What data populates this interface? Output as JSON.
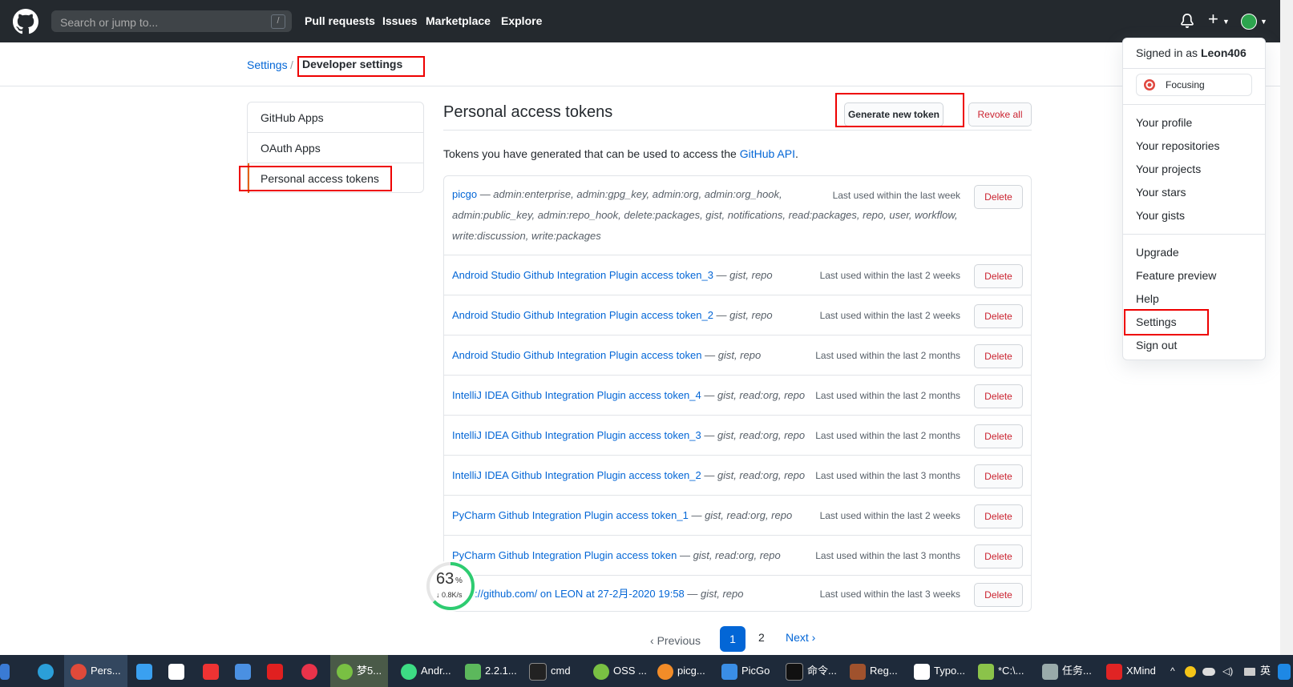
{
  "header": {
    "search_placeholder": "Search or jump to...",
    "search_key": "/",
    "nav": [
      "Pull requests",
      "Issues",
      "Marketplace",
      "Explore"
    ]
  },
  "breadcrumb": {
    "settings": "Settings",
    "separator": "/",
    "current": "Developer settings"
  },
  "sidebar": {
    "items": [
      "GitHub Apps",
      "OAuth Apps",
      "Personal access tokens"
    ]
  },
  "main": {
    "title": "Personal access tokens",
    "generate_label": "Generate new token",
    "revoke_label": "Revoke all",
    "desc_text": "Tokens you have generated that can be used to access the ",
    "desc_link": "GitHub API",
    "desc_end": "."
  },
  "tokens": [
    {
      "name": "picgo",
      "scopes_line1": " — admin:enterprise, admin:gpg_key, admin:org, admin:org_hook,",
      "scopes_line2": "admin:public_key, admin:repo_hook, delete:packages, gist, notifications, read:packages, repo, user, workflow,",
      "scopes_line3": "write:discussion, write:packages",
      "last_used": "Last used within the last week",
      "delete": "Delete"
    },
    {
      "name": "Android Studio Github Integration Plugin access token_3",
      "scopes": " — gist, repo",
      "last_used": "Last used within the last 2 weeks",
      "delete": "Delete"
    },
    {
      "name": "Android Studio Github Integration Plugin access token_2",
      "scopes": " — gist, repo",
      "last_used": "Last used within the last 2 weeks",
      "delete": "Delete"
    },
    {
      "name": "Android Studio Github Integration Plugin access token",
      "scopes": " — gist, repo",
      "last_used": "Last used within the last 2 months",
      "delete": "Delete"
    },
    {
      "name": "IntelliJ IDEA Github Integration Plugin access token_4",
      "scopes": " — gist, read:org, repo",
      "last_used": "Last used within the last 2 months",
      "delete": "Delete"
    },
    {
      "name": "IntelliJ IDEA Github Integration Plugin access token_3",
      "scopes": " — gist, read:org, repo",
      "last_used": "Last used within the last 2 months",
      "delete": "Delete"
    },
    {
      "name": "IntelliJ IDEA Github Integration Plugin access token_2",
      "scopes": " — gist, read:org, repo",
      "last_used": "Last used within the last 3 months",
      "delete": "Delete"
    },
    {
      "name": "PyCharm Github Integration Plugin access token_1",
      "scopes": " — gist, read:org, repo",
      "last_used": "Last used within the last 2 weeks",
      "delete": "Delete"
    },
    {
      "name": "PyCharm Github Integration Plugin access token",
      "scopes": " — gist, read:org, repo",
      "last_used": "Last used within the last 3 months",
      "delete": "Delete"
    },
    {
      "name": "https://github.com/ on LEON at 27-2月-2020 19:58",
      "scopes": " — gist, repo",
      "last_used": "Last used within the last 3 weeks",
      "delete": "Delete"
    }
  ],
  "pagination": {
    "previous": "Previous",
    "pages": [
      "1",
      "2"
    ],
    "next": "Next"
  },
  "dropdown": {
    "signed_prefix": "Signed in as ",
    "username": "Leon406",
    "status": "Focusing",
    "group1": [
      "Your profile",
      "Your repositories",
      "Your projects",
      "Your stars",
      "Your gists"
    ],
    "group2": [
      "Upgrade",
      "Feature preview",
      "Help",
      "Settings",
      "Sign out"
    ]
  },
  "speed_meter": {
    "percent": "63",
    "percent_sign": "%",
    "rate": "↓ 0.8K/s"
  },
  "taskbar": {
    "items": [
      "Pers...",
      "梦5...",
      "Andr...",
      "2.2.1...",
      "cmd",
      "OSS ...",
      "picg...",
      "PicGo",
      "命令...",
      "Reg...",
      "Typo...",
      "*C:\\...",
      "任务...",
      "XMind"
    ],
    "tray_lang": "英"
  },
  "colors": {
    "accent": "#0366d6",
    "danger": "#cb2431",
    "topbar": "#24292e",
    "highlight": "#ee0000"
  }
}
